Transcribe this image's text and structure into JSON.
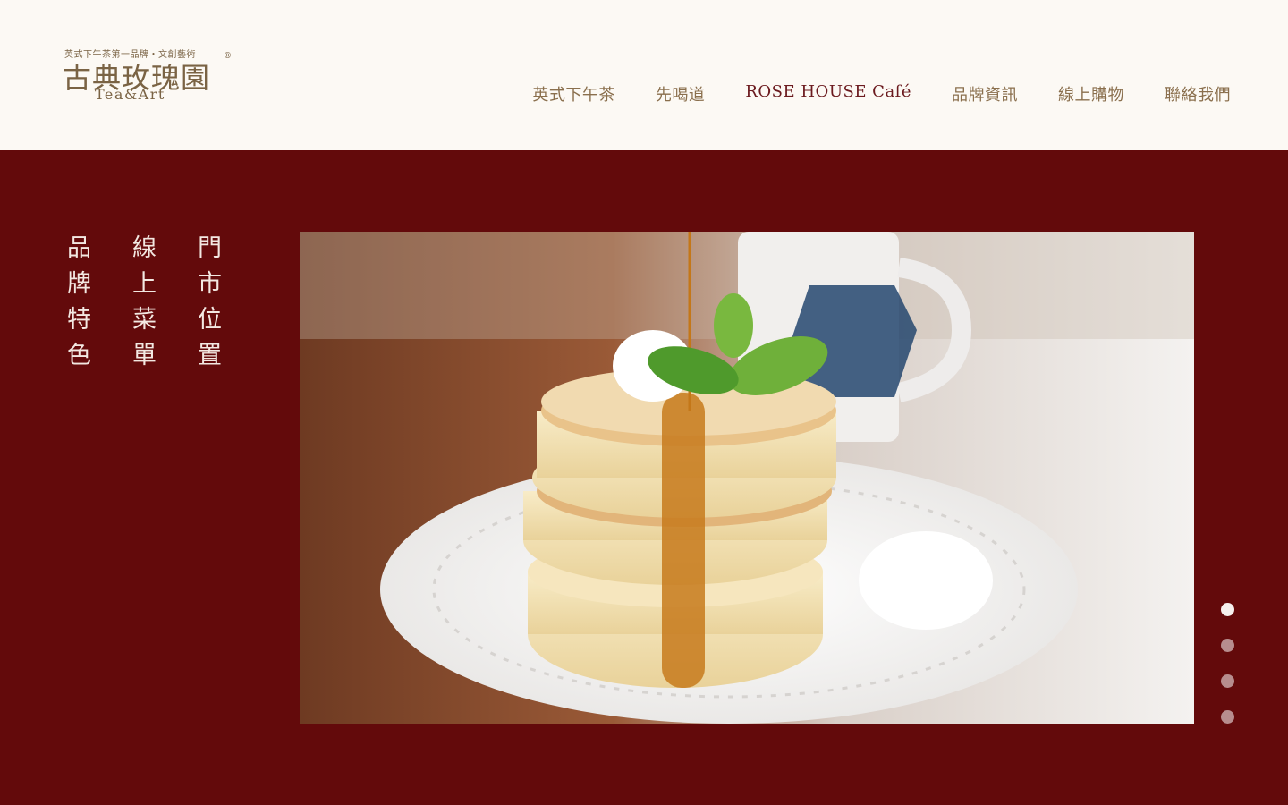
{
  "header": {
    "logo": {
      "tagline": "英式下午茶第一品牌・文創藝術",
      "name": "古典玫瑰園",
      "registered_mark": "®",
      "subtitle": "Tea&Art"
    },
    "nav": [
      {
        "label": "英式下午茶",
        "active": false
      },
      {
        "label": "先喝道",
        "active": false
      },
      {
        "label": "ROSE HOUSE Café",
        "active": true
      },
      {
        "label": "品牌資訊",
        "active": false
      },
      {
        "label": "線上購物",
        "active": false
      },
      {
        "label": "聯絡我們",
        "active": false
      }
    ]
  },
  "hero": {
    "vertical_links": [
      "門市位置",
      "線上菜單",
      "品牌特色"
    ],
    "slider": {
      "count": 4,
      "active_index": 0
    }
  },
  "colors": {
    "background": "#fcf9f4",
    "hero_bg": "#630a0b",
    "nav_text": "#8a6f4d",
    "nav_active": "#6b1a1e",
    "hero_text": "#f3e8e2"
  }
}
